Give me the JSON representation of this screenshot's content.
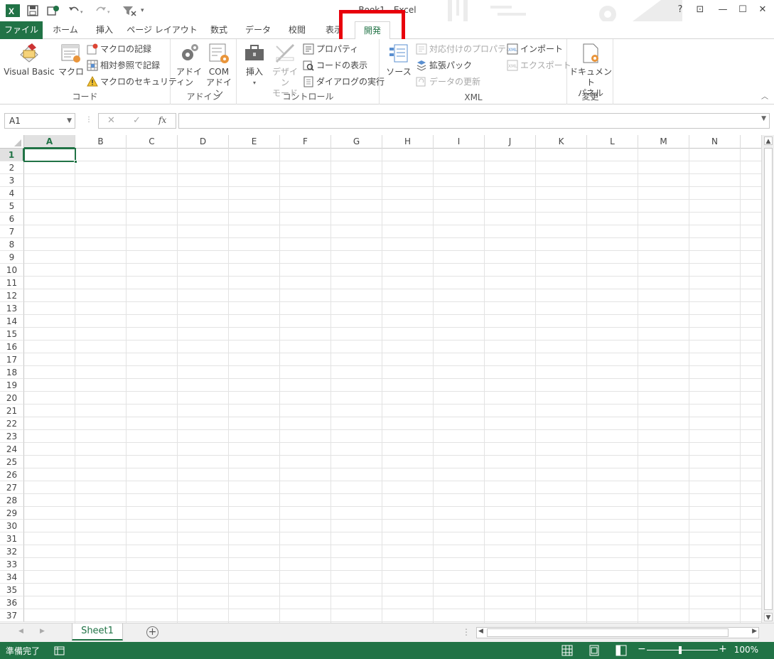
{
  "titlebar": {
    "title": "Book1 - Excel",
    "help": "?",
    "ribbon_display": "⊡",
    "minimize": "—",
    "maximize": "☐",
    "close": "✕"
  },
  "tabs": {
    "file": "ファイル",
    "home": "ホーム",
    "insert": "挿入",
    "page_layout": "ページ レイアウト",
    "formulas": "数式",
    "data": "データ",
    "review": "校閲",
    "view": "表示",
    "developer": "開発"
  },
  "ribbon": {
    "code": {
      "label": "コード",
      "visual_basic": "Visual Basic",
      "macros": "マクロ",
      "record_macro": "マクロの記録",
      "relative_refs": "相対参照で記録",
      "macro_security": "マクロのセキュリティ"
    },
    "addins": {
      "label": "アドイン",
      "addins": "アドイン",
      "com_line1": "COM",
      "com_line2": "アドイン"
    },
    "controls": {
      "label": "コントロール",
      "insert": "挿入",
      "design_line1": "デザイン",
      "design_line2": "モード",
      "properties": "プロパティ",
      "view_code": "コードの表示",
      "run_dialog": "ダイアログの実行"
    },
    "xml": {
      "label": "XML",
      "source": "ソース",
      "map_properties": "対応付けのプロパティ",
      "expansion_packs": "拡張パック",
      "refresh_data": "データの更新",
      "import": "インポート",
      "export": "エクスポート"
    },
    "modify": {
      "label": "変更",
      "doc_panel_line1": "ドキュメント",
      "doc_panel_line2": "パネル"
    }
  },
  "formula_bar": {
    "name_box": "A1",
    "fx": "fx",
    "cancel": "✕",
    "enter": "✓"
  },
  "grid": {
    "columns": [
      "A",
      "B",
      "C",
      "D",
      "E",
      "F",
      "G",
      "H",
      "I",
      "J",
      "K",
      "L",
      "M",
      "N"
    ],
    "rows": [
      "1",
      "2",
      "3",
      "4",
      "5",
      "6",
      "7",
      "8",
      "9",
      "10",
      "11",
      "12",
      "13",
      "14",
      "15",
      "16",
      "17",
      "18",
      "19",
      "20",
      "21",
      "22",
      "23",
      "24",
      "25",
      "26",
      "27",
      "28",
      "29",
      "30",
      "31",
      "32",
      "33",
      "34",
      "35",
      "36",
      "37"
    ],
    "active_cell": "A1"
  },
  "sheets": {
    "tabs": [
      "Sheet1"
    ],
    "add": "+"
  },
  "status": {
    "ready": "準備完了",
    "zoom": "100%",
    "zoom_out": "−",
    "zoom_in": "+"
  },
  "colors": {
    "excel_green": "#217346",
    "highlight_red": "#e8000b"
  }
}
